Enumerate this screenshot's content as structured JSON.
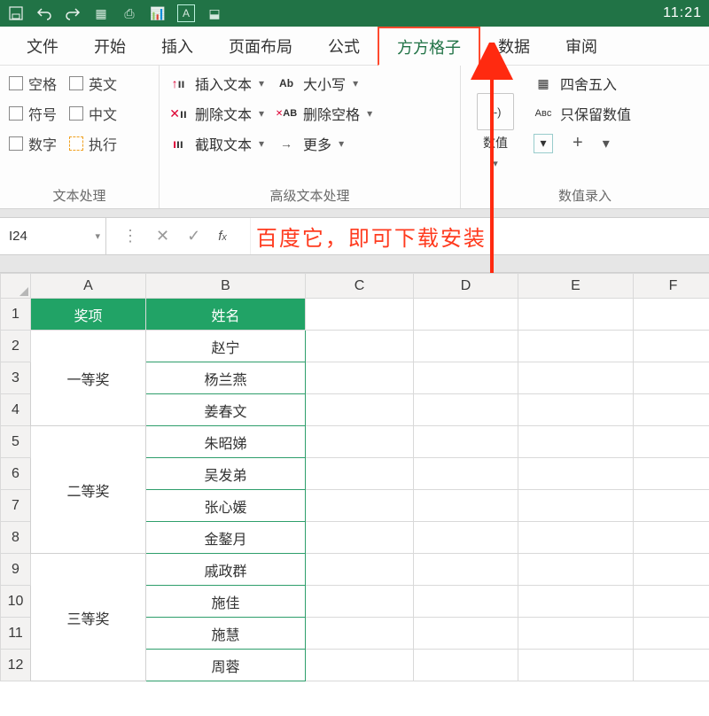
{
  "titlebar": {
    "right_text": "11:21"
  },
  "tabs": [
    {
      "id": "file",
      "label": "文件"
    },
    {
      "id": "home",
      "label": "开始"
    },
    {
      "id": "insert",
      "label": "插入"
    },
    {
      "id": "layout",
      "label": "页面布局"
    },
    {
      "id": "formulas",
      "label": "公式"
    },
    {
      "id": "ffgz",
      "label": "方方格子",
      "active": true
    },
    {
      "id": "data",
      "label": "数据"
    },
    {
      "id": "review",
      "label": "审阅"
    }
  ],
  "ribbon": {
    "group1": {
      "label": "文本处理",
      "checks_col1": [
        "空格",
        "符号",
        "数字"
      ],
      "checks_col2": [
        "英文",
        "中文",
        "执行"
      ]
    },
    "group2": {
      "label": "高级文本处理",
      "col1": [
        "插入文本",
        "删除文本",
        "截取文本"
      ],
      "col2": [
        "大小写",
        "删除空格",
        "更多"
      ]
    },
    "group3": {
      "label": "数值录入",
      "big_btn": "数值",
      "col2_btn1": "四舍五入",
      "col2_btn2": "只保留数值"
    }
  },
  "namebox": {
    "value": "I24"
  },
  "annotation_text": "百度它，即可下载安装",
  "columns": [
    "A",
    "B",
    "C",
    "D",
    "E",
    "F"
  ],
  "row_numbers": [
    1,
    2,
    3,
    4,
    5,
    6,
    7,
    8,
    9,
    10,
    11,
    12
  ],
  "headers": {
    "A": "奖项",
    "B": "姓名"
  },
  "data": {
    "groups": [
      {
        "prize": "一等奖",
        "names": [
          "赵宁",
          "杨兰燕",
          "姜春文"
        ]
      },
      {
        "prize": "二等奖",
        "names": [
          "朱昭娣",
          "吴发弟",
          "张心媛",
          "金鏊月"
        ]
      },
      {
        "prize": "三等奖",
        "names": [
          "戚政群",
          "施佳",
          "施慧",
          "周蓉"
        ]
      }
    ]
  }
}
